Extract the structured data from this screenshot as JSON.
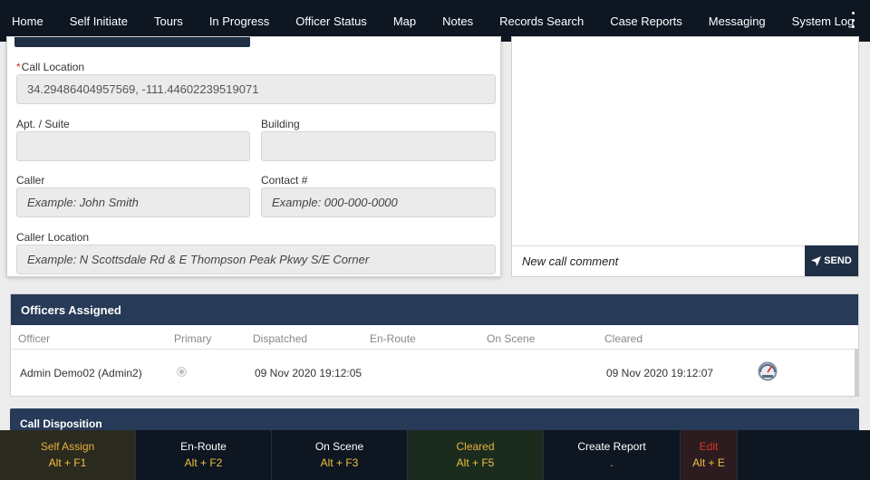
{
  "nav": {
    "items": [
      "Home",
      "Self Initiate",
      "Tours",
      "In Progress",
      "Officer Status",
      "Map",
      "Notes",
      "Records Search",
      "Case Reports",
      "Messaging",
      "System Log"
    ],
    "menu_icon": "kebab-menu-icon"
  },
  "form": {
    "call_location": {
      "required_mark": "*",
      "label": "Call Location",
      "value": "34.29486404957569, -111.44602239519071"
    },
    "apt_suite": {
      "label": "Apt. / Suite",
      "value": ""
    },
    "building": {
      "label": "Building",
      "value": ""
    },
    "caller": {
      "label": "Caller",
      "placeholder": "Example: John Smith"
    },
    "contact": {
      "label": "Contact #",
      "placeholder": "Example: 000-000-0000"
    },
    "caller_location": {
      "label": "Caller Location",
      "placeholder": "Example: N Scottsdale Rd & E Thompson Peak Pkwy S/E Corner"
    }
  },
  "comments": {
    "placeholder": "New call comment",
    "send_label": "SEND",
    "send_icon": "paper-plane-icon"
  },
  "officers": {
    "title": "Officers Assigned",
    "columns": [
      "Officer",
      "Primary",
      "Dispatched",
      "En-Route",
      "On Scene",
      "Cleared"
    ],
    "rows": [
      {
        "officer": "Admin Demo02 (Admin2)",
        "primary": false,
        "dispatched": "09 Nov 2020 19:12:05",
        "en_route": "",
        "on_scene": "",
        "cleared": "09 Nov 2020 19:12:07",
        "status_icon": "gauge-icon"
      }
    ]
  },
  "disposition": {
    "title": "Call Disposition"
  },
  "actions": [
    {
      "label": "Self Assign",
      "key": "Alt + F1"
    },
    {
      "label": "En-Route",
      "key": "Alt + F2"
    },
    {
      "label": "On Scene",
      "key": "Alt + F3"
    },
    {
      "label": "Cleared",
      "key": "Alt + F5"
    },
    {
      "label": "Create Report",
      "key": "."
    },
    {
      "label": "Edit",
      "key": "Alt + E"
    }
  ],
  "colors": {
    "nav_bg": "#0d1621",
    "panel_header": "#273a57",
    "required": "#dd2222",
    "self_assign_text": "#e8b23a",
    "cleared_text": "#e8b23a",
    "edit_label": "#d9342b",
    "key_highlight": "#f0c040"
  }
}
